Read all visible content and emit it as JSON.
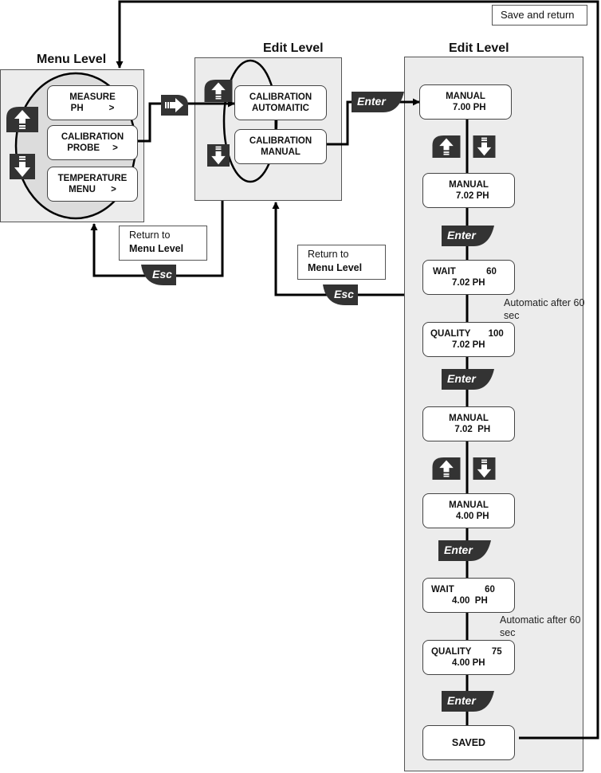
{
  "menu_level": {
    "title": "Menu Level",
    "items": [
      {
        "line1": "MEASURE",
        "line2": "PH          >"
      },
      {
        "line1": "CALIBRATION",
        "line2": "PROBE     >"
      },
      {
        "line1": "TEMPERATURE",
        "line2": "MENU      >"
      }
    ]
  },
  "edit_level_1": {
    "title": "Edit Level",
    "items": [
      {
        "line1": "CALIBRATION",
        "line2": "AUTOMAITIC"
      },
      {
        "line1": "CALIBRATION",
        "line2": "MANUAL"
      }
    ]
  },
  "edit_level_2": {
    "title": "Edit Level",
    "steps": [
      {
        "line1": "MANUAL",
        "line2": "   7.00 PH"
      },
      {
        "line1": "MANUAL",
        "line2": "   7.02 PH"
      },
      {
        "line1": "WAIT            60",
        "line2": "7.02 PH"
      },
      {
        "line1": "QUALITY       100",
        "line2": "7.02 PH"
      },
      {
        "line1": "MANUAL",
        "line2": "   7.02  PH"
      },
      {
        "line1": "MANUAL",
        "line2": "   4.00 PH"
      },
      {
        "line1": "WAIT            60",
        "line2": "4.00  PH"
      },
      {
        "line1": "QUALITY        75",
        "line2": "4.00 PH"
      },
      {
        "line1": "SAVED",
        "line2": ""
      }
    ],
    "auto_note_1": {
      "line1": "Automatic after 60",
      "line2": "sec"
    },
    "auto_note_2": {
      "line1": "Automatic after 60",
      "line2": "sec"
    }
  },
  "keys": {
    "enter": "Enter",
    "esc": "Esc",
    "up_icon": "up-arrow-key-icon",
    "down_icon": "down-arrow-key-icon",
    "right_icon": "right-arrow-key-icon"
  },
  "notes": {
    "return_1": {
      "line1": "Return to",
      "line2": "Menu Level"
    },
    "return_2": {
      "line1": "Return to",
      "line2": "Menu Level"
    },
    "save_return": "Save and return"
  },
  "colors": {
    "key_fill": "#333333",
    "panel_fill": "#ececec",
    "line": "#000000"
  }
}
